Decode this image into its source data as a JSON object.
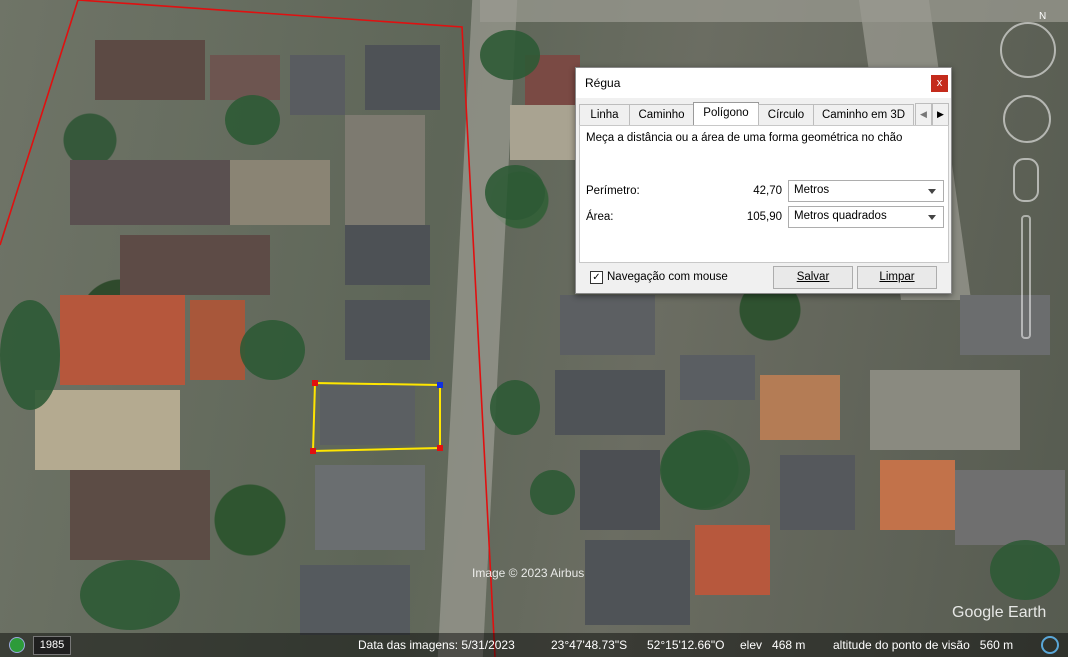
{
  "map": {
    "credit": "Image © 2023 Airbus",
    "logo": "Google Earth"
  },
  "dialog": {
    "title": "Régua",
    "close_label": "x",
    "tabs": [
      {
        "label": "Linha",
        "active": false
      },
      {
        "label": "Caminho",
        "active": false
      },
      {
        "label": "Polígono",
        "active": true
      },
      {
        "label": "Círculo",
        "active": false
      },
      {
        "label": "Caminho em 3D",
        "active": false
      }
    ],
    "description": "Meça a distância ou a área de uma forma geométrica no chão",
    "perimeter": {
      "label": "Perímetro:",
      "value": "42,70",
      "unit": "Metros"
    },
    "area": {
      "label": "Área:",
      "value": "105,90",
      "unit": "Metros quadrados"
    },
    "mouse_nav": {
      "label": "Navegação com mouse",
      "checked": true
    },
    "save_label": "Salvar",
    "clear_label": "Limpar"
  },
  "status": {
    "year": "1985",
    "imagery_date": "Data das imagens: 5/31/2023",
    "latitude": "23°47'48.73\"S",
    "longitude": "52°15'12.66\"O",
    "elevation": "elev   468 m",
    "eye_altitude": "altitude do ponto de visão   560 m"
  },
  "colors": {
    "polygon": "#ffe600",
    "boundary": "#e01010",
    "vertex_start": "#e01010",
    "vertex_active": "#1030e0",
    "close_button": "#c42b1c"
  },
  "icons": {
    "compass": "compass-icon",
    "look": "look-joystick-icon",
    "move": "move-joystick-icon",
    "street_view": "pegman-icon",
    "zoom": "zoom-slider-icon",
    "tab_next": "chevron-right-icon",
    "tab_prev": "chevron-left-icon"
  }
}
